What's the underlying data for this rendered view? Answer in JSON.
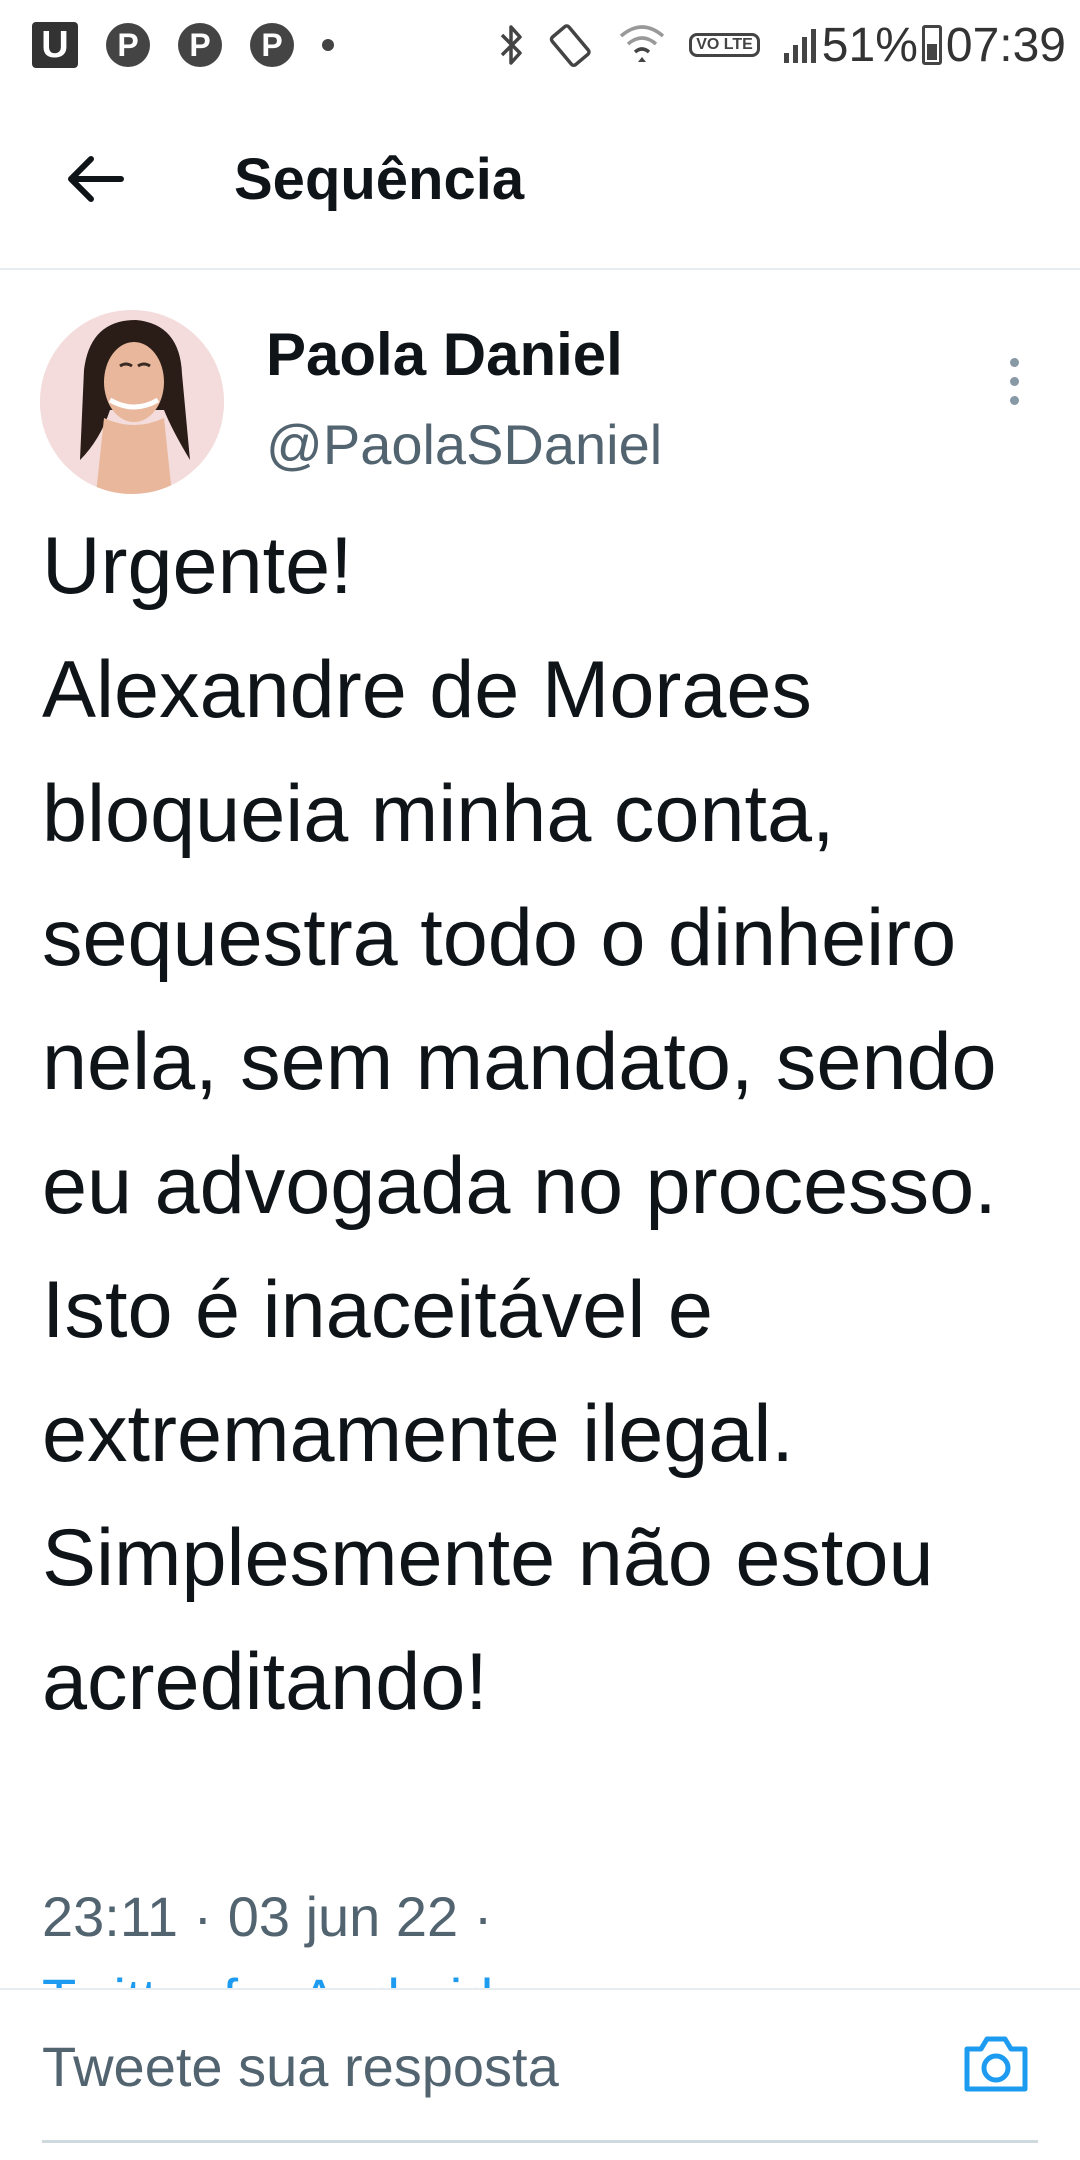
{
  "status_bar": {
    "left_icons": [
      "u-app-icon",
      "pinterest-icon",
      "pinterest-icon",
      "pinterest-icon",
      "dot-icon"
    ],
    "lte_label": "VO LTE",
    "battery": "51%",
    "time": "07:39"
  },
  "header": {
    "title": "Sequência"
  },
  "tweet": {
    "author_name": "Paola Daniel",
    "author_handle": "@PaolaSDaniel",
    "text": "Urgente!\nAlexandre de Moraes bloqueia minha conta, sequestra todo o dinheiro nela, sem mandato, sendo eu advogada no processo. Isto é inaceitável e extremamente ilegal. Simplesmente não estou acreditando!",
    "meta": "23:11 · 03 jun 22 ·",
    "source": "Twitter for Android"
  },
  "reply": {
    "placeholder": "Tweete sua resposta"
  },
  "colors": {
    "accent": "#1d9bf0",
    "text_primary": "#0f1419",
    "text_secondary": "#536471",
    "divider": "#e6ecf0"
  }
}
